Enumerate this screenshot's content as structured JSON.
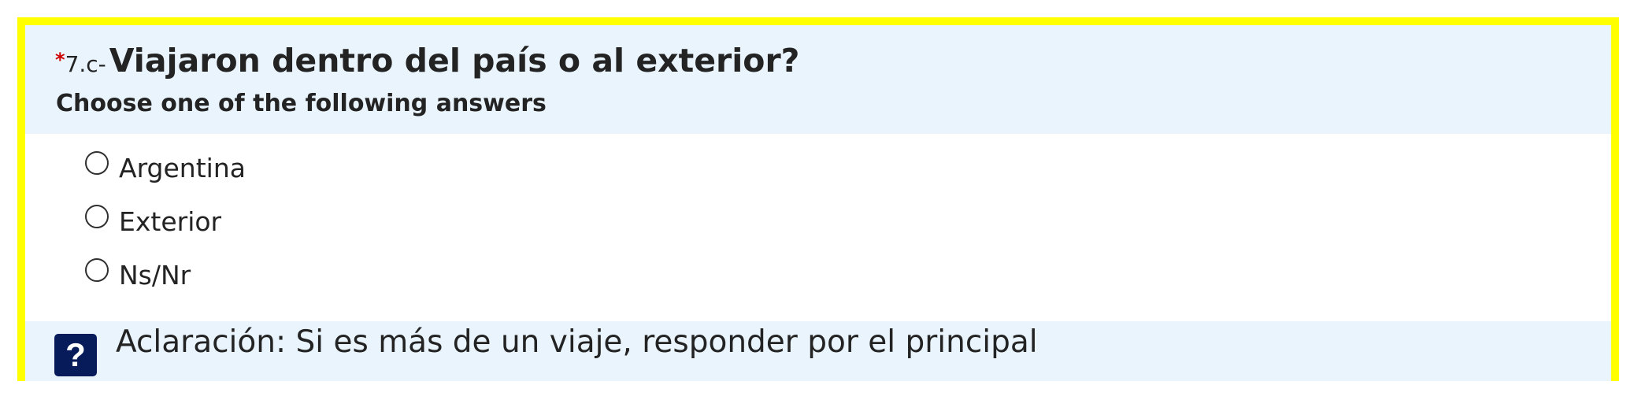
{
  "colors": {
    "frame_border": "#ffff00",
    "header_background": "#eaf4fd",
    "mandatory_star": "#d00000",
    "text": "#232323",
    "help_icon_background": "#071b5b"
  },
  "question": {
    "mandatory_marker": "*",
    "number": "7.c-",
    "text": "Viajaron dentro del país o al exterior?",
    "help": "Choose one of the following answers"
  },
  "answers": [
    {
      "label": "Argentina",
      "selected": false
    },
    {
      "label": "Exterior",
      "selected": false
    },
    {
      "label": "Ns/Nr",
      "selected": false
    }
  ],
  "note": {
    "icon": "question-mark-icon",
    "icon_text": "?",
    "text": "Aclaración: Si es más de un viaje, responder por el principal"
  }
}
